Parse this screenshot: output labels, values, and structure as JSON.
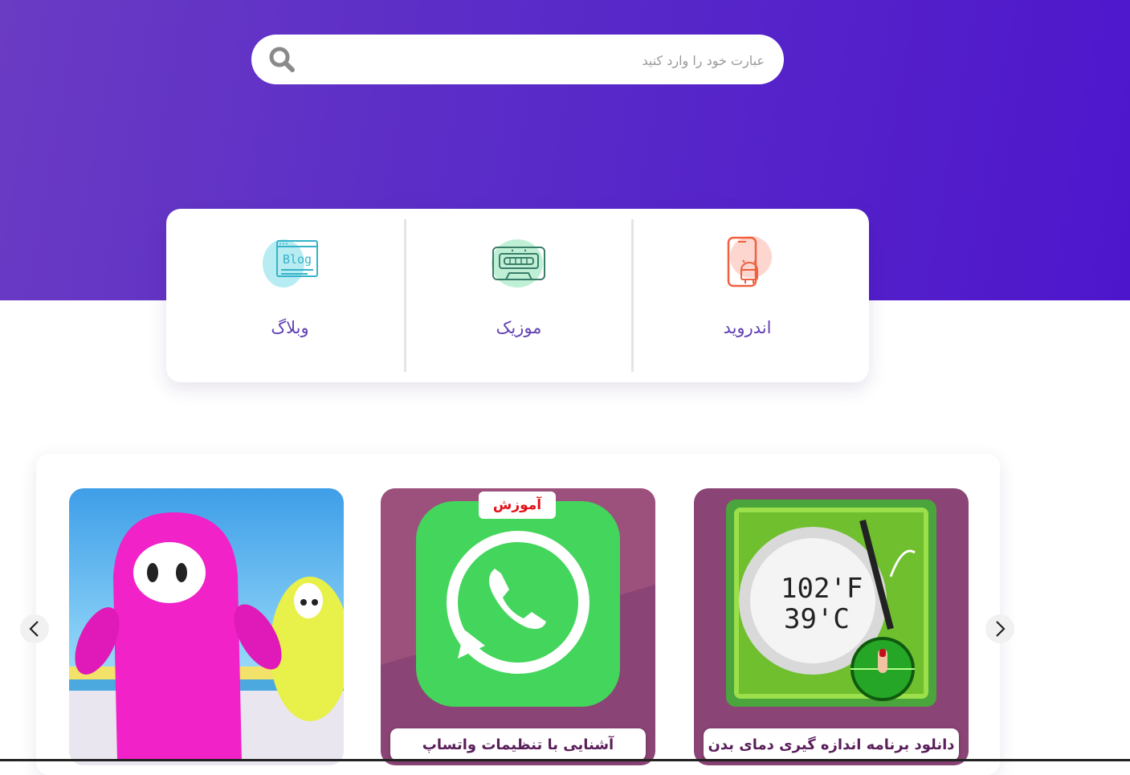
{
  "search": {
    "placeholder": "عبارت خود را وارد کنید",
    "value": "",
    "icon": "search-icon"
  },
  "categories": [
    {
      "label": "اندروید",
      "icon": "android-phone-icon",
      "accent": "#f56b4b"
    },
    {
      "label": "موزیک",
      "icon": "cassette-icon",
      "accent": "#3ab58a"
    },
    {
      "label": "وبلاگ",
      "icon": "blog-icon",
      "accent": "#3bb3c9"
    }
  ],
  "slider": {
    "cards": [
      {
        "title": "دانلود برنامه اندازه گیری دمای بدن",
        "image_text_1": "102'F",
        "image_text_2": "39'C",
        "icon": "thermometer-app-icon"
      },
      {
        "title": "آشنایی با تنظیمات واتساپ",
        "badge": "آموزش",
        "icon": "whatsapp-icon"
      },
      {
        "title": "",
        "icon": "game-characters-image"
      }
    ],
    "prev_icon": "chevron-left-icon",
    "next_icon": "chevron-right-icon"
  },
  "colors": {
    "hero_start": "#6a3bc3",
    "hero_end": "#4e16cc",
    "category_text": "#6141b4",
    "card_title_text": "#5a1f5a"
  }
}
